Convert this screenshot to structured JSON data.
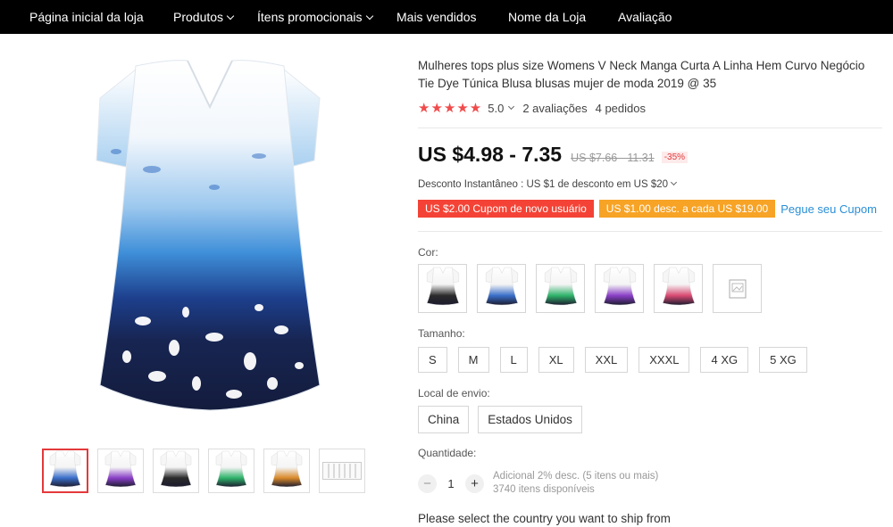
{
  "nav": {
    "items": [
      {
        "label": "Página inicial da loja",
        "dropdown": false
      },
      {
        "label": "Produtos",
        "dropdown": true
      },
      {
        "label": "Ítens promocionais",
        "dropdown": true
      },
      {
        "label": "Mais vendidos",
        "dropdown": false
      },
      {
        "label": "Nome da Loja",
        "dropdown": false
      },
      {
        "label": "Avaliação",
        "dropdown": false
      }
    ]
  },
  "product": {
    "title": "Mulheres tops plus size Womens V Neck Manga Curta A Linha Hem Curvo Negócio Tie Dye Túnica Blusa blusas mujer de moda 2019 @ 35",
    "stars": "★★★★★",
    "rating": "5.0",
    "reviews": "2 avaliações",
    "orders": "4 pedidos",
    "price": "US $4.98 - 7.35",
    "old_price": "US $7.66 - 11.31",
    "discount": "-35%",
    "instant_discount": "Desconto Instantâneo : US $1 de desconto em US $20",
    "coupons": {
      "new_user": "US $2.00 Cupom de novo usuário",
      "per_amount": "US $1.00 desc. a cada US $19.00",
      "get_link": "Pegue seu Cupom"
    }
  },
  "color": {
    "label": "Cor:",
    "swatches": [
      {
        "name": "black",
        "accent": "#2b2b2b"
      },
      {
        "name": "blue",
        "accent": "#3a6fc9"
      },
      {
        "name": "green",
        "accent": "#2fb36a"
      },
      {
        "name": "purple",
        "accent": "#8a3fc7"
      },
      {
        "name": "pink",
        "accent": "#d94a72"
      },
      {
        "name": "placeholder",
        "accent": "#cccccc"
      }
    ]
  },
  "size": {
    "label": "Tamanho:",
    "options": [
      "S",
      "M",
      "L",
      "XL",
      "XXL",
      "XXXL",
      "4 XG",
      "5 XG"
    ]
  },
  "shipping": {
    "label": "Local de envio:",
    "options": [
      "China",
      "Estados Unidos"
    ],
    "note": "Please select the country you want to ship from"
  },
  "quantity": {
    "label": "Quantidade:",
    "minus": "−",
    "plus": "+",
    "value": "1",
    "bulk_discount": "Adicional 2% desc. (5 itens ou mais)",
    "available": "3740 itens disponíveis"
  },
  "thumbnails": [
    {
      "name": "blue",
      "accent": "#3a6fc9",
      "selected": true
    },
    {
      "name": "purple",
      "accent": "#8a3fc7",
      "selected": false
    },
    {
      "name": "black",
      "accent": "#2b2b2b",
      "selected": false
    },
    {
      "name": "green",
      "accent": "#2fb36a",
      "selected": false
    },
    {
      "name": "orange",
      "accent": "#d98a2b",
      "selected": false
    },
    {
      "name": "size-chart",
      "accent": "#bbbbbb",
      "selected": false
    }
  ],
  "colors": {
    "nav_bg": "#000000",
    "star": "#f04b4b",
    "coupon_red": "#f44336",
    "coupon_orange": "#f7a325",
    "link": "#2a8fd6",
    "selected_border": "#e4393c"
  }
}
